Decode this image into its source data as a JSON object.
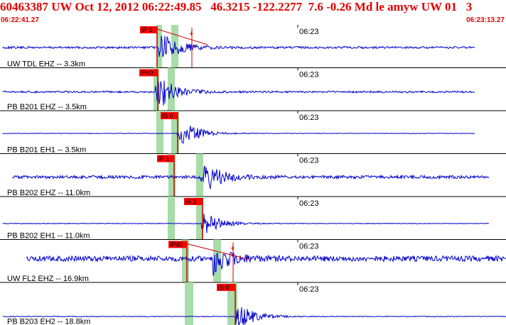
{
  "header": {
    "title": "60463387 UW Oct 12, 2012 06:22:49.85   46.3215 -122.2277  7.6 -0.26 Md le amyw UW 01   3",
    "start_time": "06:22:41.27",
    "end_time": "06:23:13.27"
  },
  "time_tick_label": "06:23",
  "colors": {
    "trace": "#0000cc",
    "pick_flag": "#ff0000",
    "window": "#a8dca8",
    "header": "#e00000"
  },
  "panels": [
    {
      "label": "UW TDL EHZ -- 3.3km",
      "pick": "iP 1"
    },
    {
      "label": "PB B201 EHZ -- 3.5km",
      "pick": "iPc0"
    },
    {
      "label": "PB B201 EH1 -- 3.5km",
      "pick": "iS 0"
    },
    {
      "label": "PB B202 EHZ -- 11.0km",
      "pick": "iP 1"
    },
    {
      "label": "PB B202 EH1 -- 11.0km",
      "pick": "iS 1"
    },
    {
      "label": "UW FL2 EHZ -- 16.9km",
      "pick": "iPd0"
    },
    {
      "label": "PB B203 EH2 -- 18.8km",
      "pick": "iS 0"
    }
  ]
}
